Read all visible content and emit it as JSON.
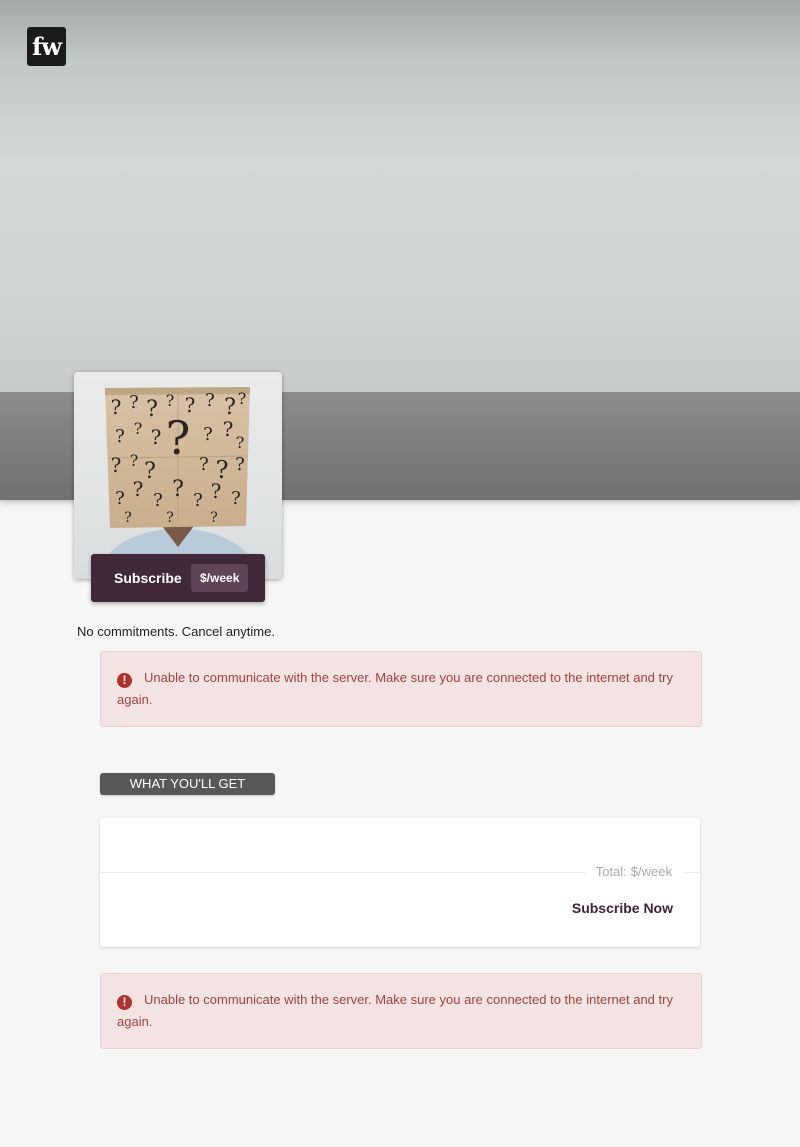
{
  "header": {
    "logo_text": "fw"
  },
  "profile": {
    "subscribe_label": "Subscribe",
    "price_label": "$/week",
    "no_commitment_text": "No commitments. Cancel anytime."
  },
  "alerts": [
    {
      "icon": "exclamation-circle-icon",
      "text": "Unable to communicate with the server. Make sure you are connected to the internet and try again."
    },
    {
      "icon": "exclamation-circle-icon",
      "text": "Unable to communicate with the server. Make sure you are connected to the internet and try again."
    }
  ],
  "offer": {
    "section_label": "WHAT YOU'LL GET",
    "total_label": "Total:",
    "total_value": "$/week",
    "subscribe_now_label": "Subscribe Now"
  },
  "colors": {
    "accent": "#42293a",
    "alert_text": "#a3423f",
    "alert_background": "#f3e4e3",
    "page_background": "#f6f6f6"
  }
}
